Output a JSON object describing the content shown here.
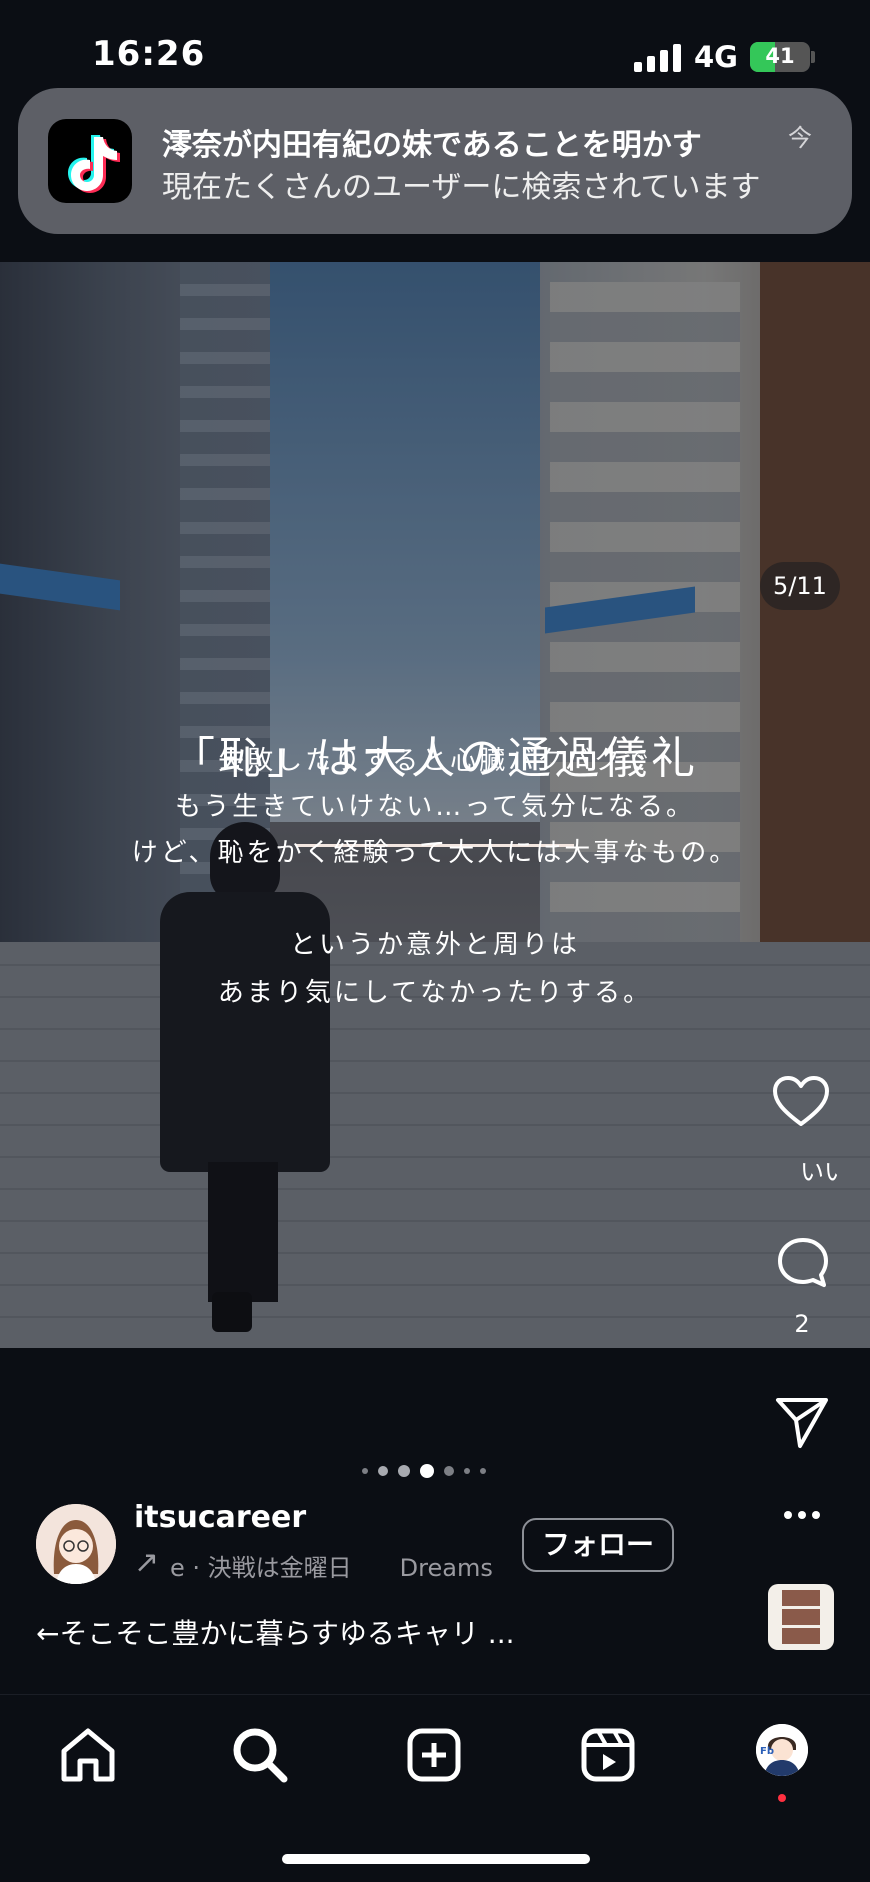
{
  "status_bar": {
    "time": "16:26",
    "network": "4G",
    "battery": "41"
  },
  "notification": {
    "app_icon": "tiktok-icon",
    "title": "澪奈が内田有紀の妹であることを明かす",
    "body": "現在たくさんのユーザーに検索されています",
    "time": "今"
  },
  "post": {
    "counter": "5/11",
    "headline": "「恥」は大人の通過儀礼",
    "body_lines": [
      "失敗したりすると心臓バクバクで",
      "もう生きていけない…って気分になる。",
      "けど、恥をかく経験って大人には大事なもの。",
      "というか意外と周りは",
      "あまり気にしてなかったりする。"
    ],
    "carousel_dots": 7,
    "carousel_active_dot": 4
  },
  "actions": {
    "like_label": "いい",
    "comment_count": "2",
    "icons": [
      "heart-icon",
      "comment-icon",
      "share-icon",
      "more-icon"
    ]
  },
  "author": {
    "username": "itsucareer",
    "music": "e · 決戦は金曜日　　Dreams C",
    "follow_label": "フォロー",
    "caption": "←そこそこ豊かに暮らすゆるキャリ ..."
  },
  "bottom_nav": {
    "items": [
      "home-icon",
      "search-icon",
      "create-icon",
      "reels-icon",
      "profile-avatar"
    ],
    "notification_color": "#ff3040"
  },
  "colors": {
    "background": "#0b0e14",
    "battery_green": "#34c759",
    "notification_bg": "#5d5f66"
  }
}
